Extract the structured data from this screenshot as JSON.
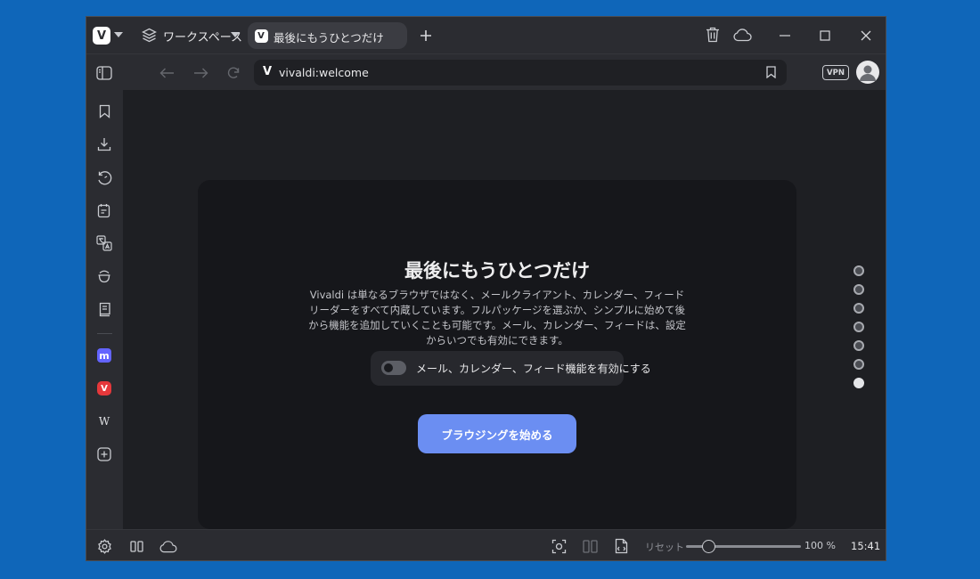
{
  "titlebar": {
    "workspace_label": "ワークスペース",
    "tab_title": "最後にもうひとつだけ",
    "logo_letter": "V"
  },
  "addressbar": {
    "url": "vivaldi:welcome",
    "vpn_label": "VPN"
  },
  "welcome": {
    "heading": "最後にもうひとつだけ",
    "description": "Vivaldi は単なるブラウザではなく、メールクライアント、カレンダー、フィードリーダーをすべて内蔵しています。フルパッケージを選ぶか、シンプルに始めて後から機能を追加していくことも可能です。メール、カレンダー、フィードは、設定からいつでも有効にできます。",
    "toggle_label": "メール、カレンダー、フィード機能を有効にする",
    "toggle_on": false,
    "start_button": "ブラウジングを始める",
    "pager_total": 7,
    "pager_active": 7
  },
  "sidebar": {
    "panels": [
      "bookmarks-icon",
      "downloads-icon",
      "history-icon",
      "notes-icon",
      "translate-icon",
      "reading-list-icon",
      "window-panel-icon",
      "mastodon-icon",
      "vivaldi-social-icon",
      "wikipedia-icon",
      "add-panel-icon"
    ],
    "wiki_glyph": "W"
  },
  "statusbar": {
    "reset_label": "リセット",
    "zoom": "100 %",
    "zoom_level": 0.16,
    "clock": "15:41"
  },
  "colors": {
    "accent": "#6b8ef2",
    "desktop": "#0f66b9",
    "chrome": "#2b2c31",
    "mastodon": "#6364ff",
    "vivaldi_red": "#e5383b"
  }
}
